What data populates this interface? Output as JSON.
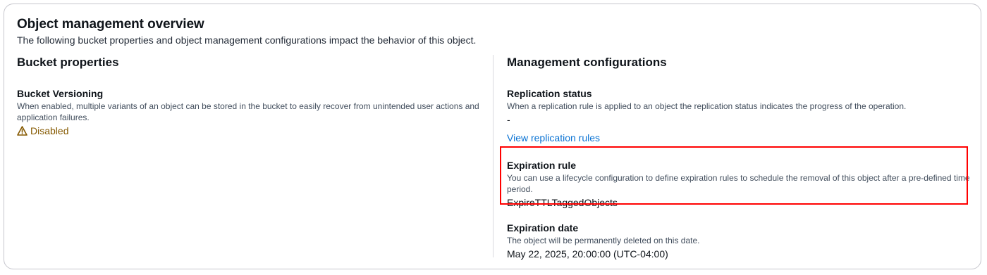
{
  "header": {
    "title": "Object management overview",
    "subtitle": "The following bucket properties and object management configurations impact the behavior of this object."
  },
  "bucket_properties": {
    "heading": "Bucket properties",
    "versioning": {
      "label": "Bucket Versioning",
      "description": "When enabled, multiple variants of an object can be stored in the bucket to easily recover from unintended user actions and application failures.",
      "status": "Disabled",
      "status_icon": "warning-icon",
      "status_color": "#855900"
    }
  },
  "management": {
    "heading": "Management configurations",
    "replication": {
      "label": "Replication status",
      "description": "When a replication rule is applied to an object the replication status indicates the progress of the operation.",
      "value": "-",
      "link": "View replication rules"
    },
    "expiration_rule": {
      "label": "Expiration rule",
      "description": "You can use a lifecycle configuration to define expiration rules to schedule the removal of this object after a pre-defined time period.",
      "value": "ExpireTTLTaggedObjects",
      "highlight_color": "#ff0000"
    },
    "expiration_date": {
      "label": "Expiration date",
      "description": "The object will be permanently deleted on this date.",
      "value": "May 22, 2025, 20:00:00 (UTC-04:00)"
    }
  },
  "colors": {
    "link": "#0972d3",
    "border": "#c6c6cd",
    "text": "#0f141a",
    "secondary_text": "#414d5c"
  }
}
